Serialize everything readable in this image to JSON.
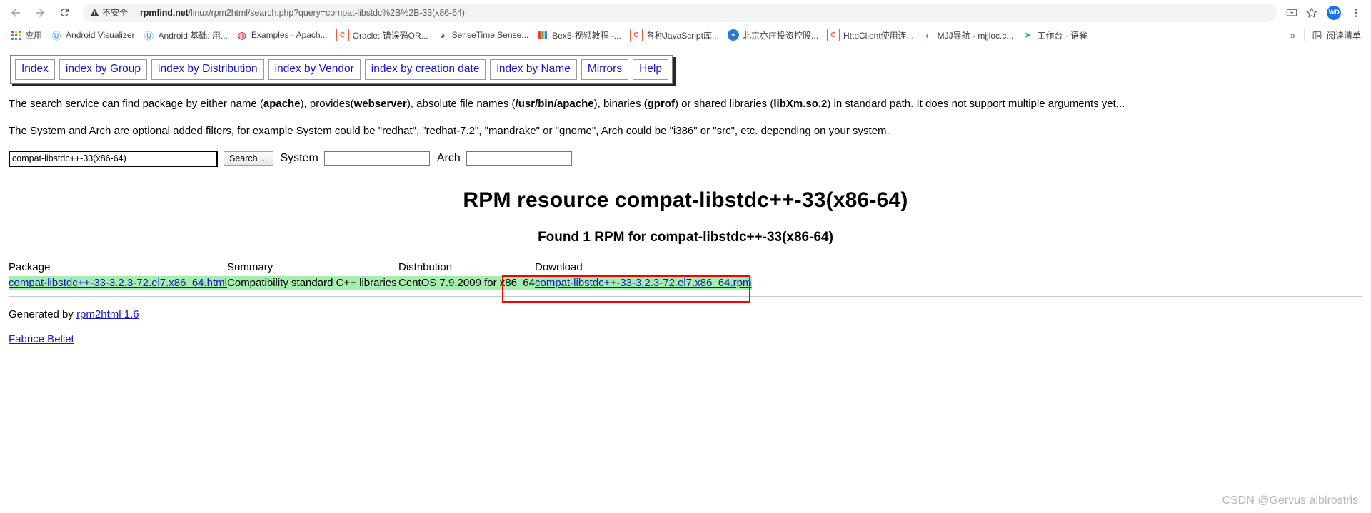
{
  "browser": {
    "back_icon": "back-arrow-icon",
    "forward_icon": "forward-arrow-icon",
    "reload_icon": "reload-icon",
    "security_label": "不安全",
    "url_host": "rpmfind.net",
    "url_path": "/linux/rpm2html/search.php?query=compat-libstdc%2B%2B-33(x86-64)",
    "url_full": "rpmfind.net/linux/rpm2html/search.php?query=compat-libstdc%2B%2B-33(x86-64)",
    "share_icon": "share-screen-icon",
    "bookmark_star_icon": "star-icon",
    "profile_initials": "WD",
    "menu_icon": "three-dot-menu-icon"
  },
  "bookmarks": {
    "apps_label": "应用",
    "apps_icon": "apps-grid-icon",
    "items": [
      {
        "label": "Android Visualizer",
        "icon": "android-visualizer-icon",
        "icon_color": "#2196f3",
        "glyph": "Ⓦ"
      },
      {
        "label": "Android 基础: 用...",
        "icon": "android-visualizer-icon",
        "icon_color": "#2196f3",
        "glyph": "Ⓦ"
      },
      {
        "label": "Examples - Apach...",
        "icon": "apache-icon",
        "icon_color": "#d22128",
        "glyph": "●"
      },
      {
        "label": "Oracle: 错误码OR...",
        "icon": "csdn-icon",
        "icon_color": "#fc5531",
        "glyph": "C"
      },
      {
        "label": "SenseTime Sense...",
        "icon": "sensetime-icon",
        "icon_color": "#5f6368",
        "glyph": "●"
      },
      {
        "label": "Bex5-视频教程 -...",
        "icon": "bex5-icon",
        "icon_color": "#4caf50",
        "glyph": "█"
      },
      {
        "label": "各种JavaScript库...",
        "icon": "csdn-icon",
        "icon_color": "#fc5531",
        "glyph": "C"
      },
      {
        "label": "北京亦庄投资控股...",
        "icon": "globe-icon",
        "icon_color": "#2979d8",
        "glyph": "●"
      },
      {
        "label": "HttpClient使用连...",
        "icon": "csdn-icon",
        "icon_color": "#fc5531",
        "glyph": "C"
      },
      {
        "label": "MJJ导航 - mjjloc.c...",
        "icon": "mjj-icon",
        "icon_color": "#34a8eb",
        "glyph": "◐"
      },
      {
        "label": "工作台 · 语雀",
        "icon": "yuque-icon",
        "icon_color": "#25b864",
        "glyph": "▶"
      }
    ],
    "overflow_icon": "overflow-chevron-icon",
    "reading_list_icon": "reading-list-icon",
    "reading_list_label": "阅读清单"
  },
  "nav": {
    "items": [
      {
        "label": "Index"
      },
      {
        "label": "index by Group"
      },
      {
        "label": "index by Distribution"
      },
      {
        "label": "index by Vendor"
      },
      {
        "label": "index by creation date"
      },
      {
        "label": "index by Name"
      },
      {
        "label": "Mirrors"
      },
      {
        "label": "Help"
      }
    ]
  },
  "intro": {
    "p1_a": "The search service can find package by either name (",
    "p1_b1": "apache",
    "p1_c": "), provides(",
    "p1_b2": "webserver",
    "p1_d": "), absolute file names (",
    "p1_b3": "/usr/bin/apache",
    "p1_e": "), binaries (",
    "p1_b4": "gprof",
    "p1_f": ") or shared libraries (",
    "p1_b5": "libXm.so.2",
    "p1_g": ") in standard path. It does not support multiple arguments yet...",
    "p2": "The System and Arch are optional added filters, for example System could be \"redhat\", \"redhat-7.2\", \"mandrake\" or \"gnome\", Arch could be \"i386\" or \"src\", etc. depending on your system."
  },
  "search": {
    "query_value": "compat-libstdc++-33(x86-64)",
    "button_label": "Search ...",
    "system_label": "System",
    "system_value": "",
    "arch_label": "Arch",
    "arch_value": ""
  },
  "result": {
    "title": "RPM resource compat-libstdc++-33(x86-64)",
    "subtitle": "Found 1 RPM for compat-libstdc++-33(x86-64)",
    "headers": [
      "Package",
      "Summary",
      "Distribution",
      "Download"
    ],
    "rows": [
      {
        "package": "compat-libstdc++-33-3.2.3-72.el7.x86_64.html",
        "summary": "Compatibility standard C++ libraries",
        "distribution": "CentOS 7.9.2009 for x86_64",
        "download": "compat-libstdc++-33-3.2.3-72.el7.x86_64.rpm"
      }
    ]
  },
  "footer": {
    "generated_prefix": "Generated by ",
    "generated_link": "rpm2html 1.6",
    "author": "Fabrice Bellet"
  },
  "annotation": {
    "highlight_color": "#f40000"
  },
  "watermark": {
    "text": "CSDN @Gervus albirostris"
  }
}
